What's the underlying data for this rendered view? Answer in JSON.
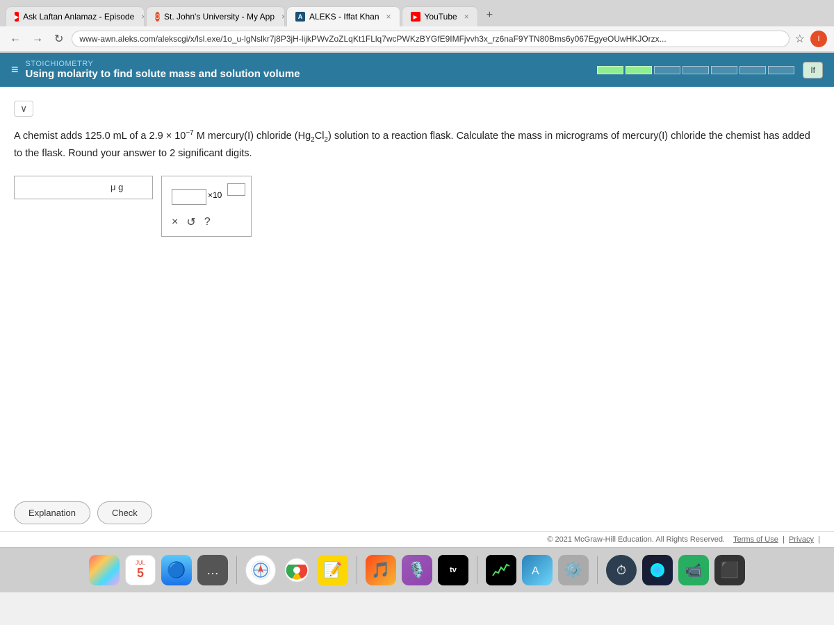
{
  "browser": {
    "tabs": [
      {
        "id": "tab1",
        "favicon_type": "youtube",
        "label": "Ask Laftan Anlamaz - Episode",
        "active": false
      },
      {
        "id": "tab2",
        "favicon_type": "o",
        "label": "St. John's University - My App",
        "active": false
      },
      {
        "id": "tab3",
        "favicon_type": "a",
        "label": "ALEKS - Iffat Khan",
        "active": true
      },
      {
        "id": "tab4",
        "favicon_type": "youtube",
        "label": "YouTube",
        "active": false
      }
    ],
    "address": "www-awn.aleks.com/alekscgi/x/lsl.exe/1o_u-lgNslkr7j8P3jH-lijkPWvZoZLqKt1FLlq7wcPWKzBYGfE9IMFjvvh3x_rz6naF9YTN80Bms6y067EgyeOUwHKJOrzx...",
    "new_tab_label": "+"
  },
  "aleks": {
    "section_label": "STOICHIOMETRY",
    "title": "Using molarity to find solute mass and solution volume",
    "progress_segments": [
      1,
      1,
      0,
      0,
      0,
      0,
      0
    ],
    "if_button_label": "If",
    "chevron_label": "∨",
    "problem_text_part1": "A chemist adds 125.0 mL of a 2.9 × 10",
    "problem_exponent": "-7",
    "problem_text_part2": "M mercury(I) chloride",
    "formula_main": "(Hg",
    "formula_sub1": "2",
    "formula_main2": "Cl",
    "formula_sub2": "2",
    "formula_end": ")",
    "problem_text_part3": "solution to a reaction flask. Calculate the mass in micrograms of mercury(I) chloride the chemist has added to the flask. Round your answer to 2 significant digits.",
    "answer_input_placeholder": "",
    "answer_unit": "μ g",
    "sci_notation_placeholder": "",
    "sci_exponent_placeholder": "",
    "x10_label": "×10",
    "sci_btn_x": "×",
    "sci_btn_undo": "↺",
    "sci_btn_help": "?",
    "explanation_button": "Explanation",
    "check_button": "Check",
    "footer_text": "© 2021 McGraw-Hill Education. All Rights Reserved.",
    "footer_terms": "Terms of Use",
    "footer_privacy": "Privacy"
  },
  "dock": {
    "date": "5",
    "month": "JUL"
  }
}
